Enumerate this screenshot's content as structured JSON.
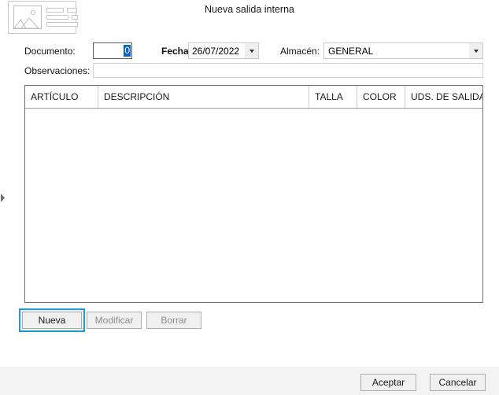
{
  "dialog": {
    "title": "Nueva salida interna",
    "icon": "document-image-placeholder-icon",
    "edge_toggle_icon": "chevron-right-icon"
  },
  "form": {
    "documento": {
      "label": "Documento:",
      "value": "0",
      "selected": true
    },
    "fecha": {
      "label": "Fecha:",
      "value": "26/07/2022",
      "dropdown_icon": "chevron-down-icon"
    },
    "almacen": {
      "label": "Almacén:",
      "value": "GENERAL",
      "dropdown_icon": "chevron-down-icon"
    },
    "observaciones": {
      "label": "Observaciones:",
      "value": "",
      "placeholder": ""
    }
  },
  "grid": {
    "columns": [
      "ARTÍCULO",
      "DESCRIPCIÓN",
      "TALLA",
      "COLOR",
      "UDS. DE SALIDA"
    ],
    "rows": []
  },
  "row_actions": {
    "nueva": "Nueva",
    "modificar": "Modificar",
    "borrar": "Borrar"
  },
  "footer": {
    "aceptar": "Aceptar",
    "cancelar": "Cancelar"
  },
  "colors": {
    "focus_ring": "#1c9ad6",
    "selection": "#0a64c8",
    "footer_bg": "#f3f3f3",
    "button_bg": "#f0f0f0",
    "disabled_text": "#8d8d8d"
  }
}
